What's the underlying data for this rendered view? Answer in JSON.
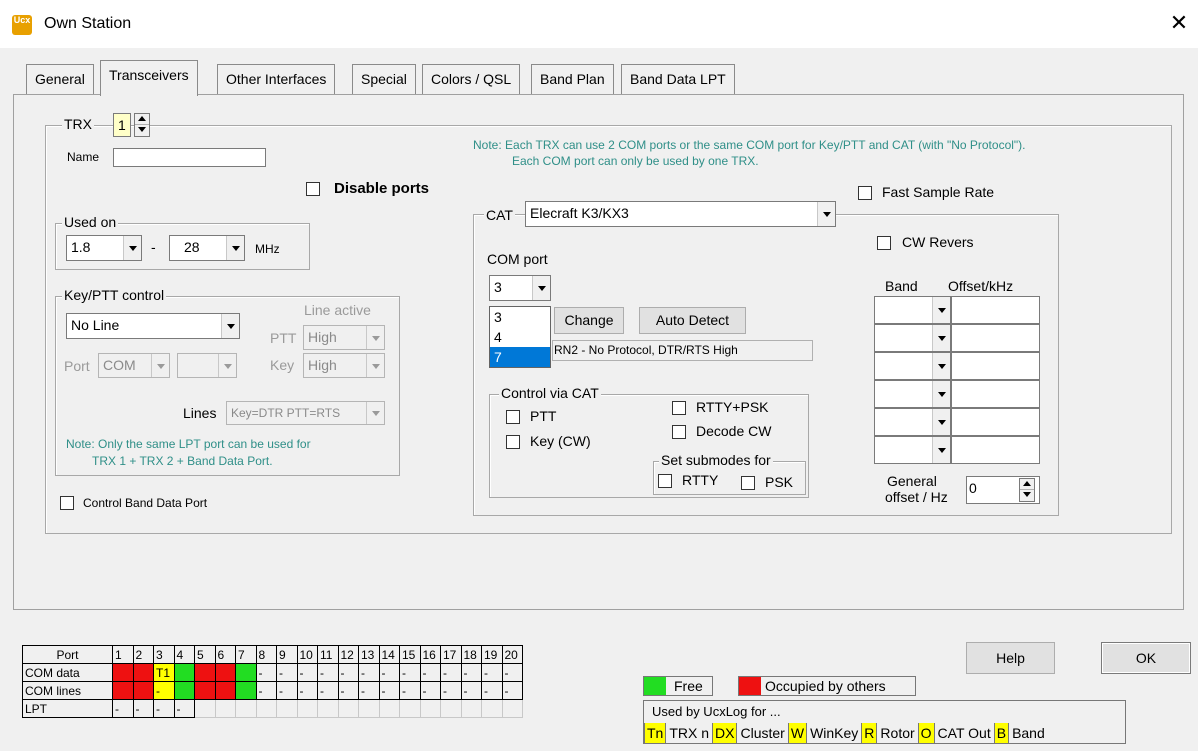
{
  "window": {
    "title": "Own Station",
    "icon_text": "Ucx"
  },
  "tabs": [
    "General",
    "Transceivers",
    "Other Interfaces",
    "Special",
    "Colors / QSL",
    "Band Plan",
    "Band Data LPT"
  ],
  "trx": {
    "label": "TRX",
    "number": "1",
    "name_label": "Name",
    "name_value": "",
    "disable_ports": "Disable ports",
    "note_line1": "Note: Each TRX can use 2 COM ports or the same COM port for Key/PTT and CAT (with \"No Protocol\").",
    "note_line2": "Each COM port can only be used by one TRX."
  },
  "used_on": {
    "label": "Used on",
    "from": "1.8",
    "dash": "-",
    "to": "28",
    "unit": "MHz"
  },
  "keyptt": {
    "label": "Key/PTT control",
    "line": "No Line",
    "line_active": "Line active",
    "ptt_label": "PTT",
    "ptt_value": "High",
    "key_label": "Key",
    "key_value": "High",
    "port_label": "Port",
    "port_value": "COM",
    "port_num": "",
    "lines_label": "Lines",
    "lines_value": "Key=DTR PTT=RTS",
    "note_line1": "Note: Only the same LPT port can be used for",
    "note_line2": "TRX 1 + TRX 2 + Band Data Port."
  },
  "control_band_data": "Control Band Data Port",
  "fast_sample": "Fast Sample Rate",
  "cat": {
    "label": "CAT",
    "radio": "Elecraft K3/KX3",
    "com_port_label": "COM port",
    "com_port_value": "3",
    "com_options": [
      "3",
      "4",
      "7"
    ],
    "com_selected": "7",
    "change": "Change",
    "auto_detect": "Auto Detect",
    "status": "RN2 - No Protocol, DTR/RTS High",
    "control_via": "Control via CAT",
    "ptt": "PTT",
    "key": "Key (CW)",
    "rtty_psk": "RTTY+PSK",
    "decode_cw": "Decode CW",
    "submodes": "Set submodes for",
    "rtty": "RTTY",
    "psk": "PSK",
    "cw_revers": "CW Revers",
    "band": "Band",
    "offset": "Offset/kHz",
    "general_offset_1": "General",
    "general_offset_2": "offset / Hz",
    "general_offset_value": "0"
  },
  "buttons": {
    "help": "Help",
    "ok": "OK"
  },
  "ports_table": {
    "header": "Port",
    "numbers": [
      "1",
      "2",
      "3",
      "4",
      "5",
      "6",
      "7",
      "8",
      "9",
      "10",
      "11",
      "12",
      "13",
      "14",
      "15",
      "16",
      "17",
      "18",
      "19",
      "20"
    ],
    "rows": [
      {
        "label": "COM data",
        "cells": [
          "",
          "",
          "T1",
          "",
          "",
          "",
          "",
          "-",
          "-",
          "-",
          "-",
          "-",
          "-",
          "-",
          "-",
          "-",
          "-",
          "-",
          "-",
          "-"
        ],
        "colors": [
          "r",
          "r",
          "y",
          "g",
          "r",
          "r",
          "g",
          "",
          "",
          "",
          "",
          "",
          "",
          "",
          "",
          "",
          "",
          "",
          "",
          ""
        ]
      },
      {
        "label": "COM lines",
        "cells": [
          "",
          "",
          "-",
          "",
          "",
          "",
          "",
          "-",
          "-",
          "-",
          "-",
          "-",
          "-",
          "-",
          "-",
          "-",
          "-",
          "-",
          "-",
          "-"
        ],
        "colors": [
          "r",
          "r",
          "y",
          "g",
          "r",
          "r",
          "g",
          "",
          "",
          "",
          "",
          "",
          "",
          "",
          "",
          "",
          "",
          "",
          "",
          ""
        ]
      },
      {
        "label": "LPT",
        "cells": [
          "-",
          "-",
          "-",
          "-",
          "",
          "",
          "",
          "",
          "",
          "",
          "",
          "",
          "",
          "",
          "",
          "",
          "",
          "",
          "",
          ""
        ],
        "colors": [
          "",
          "",
          "",
          "",
          "e",
          "e",
          "e",
          "e",
          "e",
          "e",
          "e",
          "e",
          "e",
          "e",
          "e",
          "e",
          "e",
          "e",
          "e",
          "e"
        ]
      }
    ]
  },
  "legend": {
    "free": "Free",
    "occupied": "Occupied by others",
    "used_by": "Used by UcxLog for ...",
    "items": [
      {
        "key": "Tn",
        "text": "TRX n"
      },
      {
        "key": "DX",
        "text": "Cluster"
      },
      {
        "key": "W",
        "text": "WinKey"
      },
      {
        "key": "R",
        "text": "Rotor"
      },
      {
        "key": "O",
        "text": "CAT Out"
      },
      {
        "key": "B",
        "text": "Band"
      }
    ],
    "colors": {
      "free": "#22dd22",
      "occupied": "#ee1111",
      "key": "#ffff00"
    }
  }
}
